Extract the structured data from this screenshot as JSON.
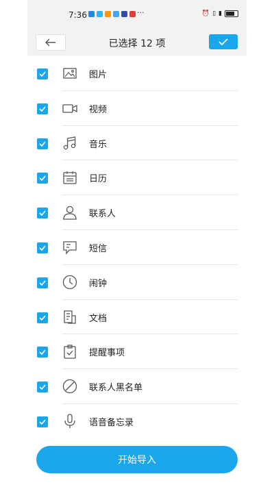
{
  "status_bar": {
    "time": "7:36",
    "more": "···"
  },
  "header": {
    "title": "已选择 12 项",
    "back_icon": "arrow-left-icon",
    "confirm_icon": "check-icon"
  },
  "items": [
    {
      "label": "图片",
      "icon": "image-icon",
      "checked": true
    },
    {
      "label": "视频",
      "icon": "video-icon",
      "checked": true
    },
    {
      "label": "音乐",
      "icon": "music-icon",
      "checked": true
    },
    {
      "label": "日历",
      "icon": "calendar-icon",
      "checked": true
    },
    {
      "label": "联系人",
      "icon": "contact-icon",
      "checked": true
    },
    {
      "label": "短信",
      "icon": "message-icon",
      "checked": true
    },
    {
      "label": "闹钟",
      "icon": "clock-icon",
      "checked": true
    },
    {
      "label": "文档",
      "icon": "document-icon",
      "checked": true
    },
    {
      "label": "提醒事项",
      "icon": "reminder-icon",
      "checked": true
    },
    {
      "label": "联系人黑名单",
      "icon": "block-icon",
      "checked": true
    },
    {
      "label": "语音备忘录",
      "icon": "microphone-icon",
      "checked": true
    }
  ],
  "footer": {
    "import_label": "开始导入"
  },
  "colors": {
    "accent": "#1aa6ea",
    "header_bg": "#f2f2f2",
    "divider": "#e6e6e6"
  }
}
